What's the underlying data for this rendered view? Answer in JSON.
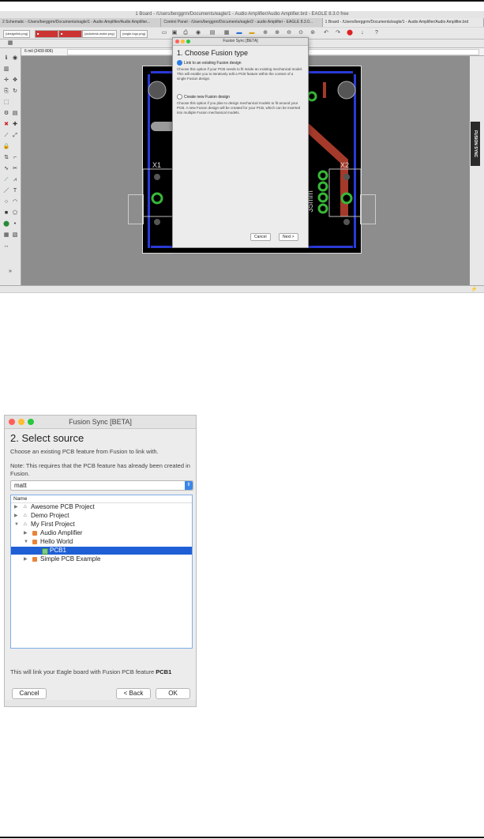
{
  "app": {
    "window_title": "1 Board - /Users/berggrm/Documents/eagle/1 - Audio Amplifier/Audio Amplifier.brd - EAGLE 8.3.0 free",
    "tabs": [
      "2 Schematic - /Users/berggrm/Documents/eagle/1 - Audio Amplifier/Audio Amplifier...",
      "Control Panel - /Users/berggrm/Documents/eagle/2 - audio Amplifier - EAGLE 8.3.0...",
      "1 Board - /Users/berggrm/Documents/eagle/1 - Audio Amplifier/Audio Amplifier.brd"
    ],
    "toolbar_images": [
      "(autodesk-make.png)",
      "(eagle-logo.png)",
      "(designlink.png)"
    ],
    "grid_readout": "6 mil (2439 806)",
    "fusion_sync_tab": "FUSION SYNC",
    "board_labels": {
      "x1": "X1",
      "x2": "X2",
      "dim": "35mm"
    }
  },
  "dialog1": {
    "title": "Fusion Sync [BETA]",
    "heading": "1. Choose Fusion type",
    "option1": "Link to an existing Fusion design",
    "option1_desc": "Choose this option if your PCB needs to fit inside an existing mechanical model. This will enable you to iteratively edit a PCB feature within the context of a single Fusion design.",
    "option2": "Create new Fusion design",
    "option2_desc": "Choose this option if you plan to design mechanical models to fit around your PCB. A new Fusion design will be created for your PCB, which can be inserted into multiple Fusion mechanical models.",
    "cancel": "Cancel",
    "next": "Next >"
  },
  "dialog2": {
    "title": "Fusion Sync [BETA]",
    "heading": "2. Select source",
    "subtitle": "Choose an existing PCB feature from Fusion to link with.",
    "note": "Note: This requires that the PCB feature has already been created in Fusion.",
    "account": "matt",
    "tree_header": "Name",
    "tree": [
      {
        "label": "Awesome PCB Project",
        "level": 0,
        "expanded": false,
        "icon": "project-icon",
        "selected": false
      },
      {
        "label": "Demo Project",
        "level": 0,
        "expanded": false,
        "icon": "project-icon",
        "selected": false
      },
      {
        "label": "My First Project",
        "level": 0,
        "expanded": true,
        "icon": "project-icon",
        "selected": false
      },
      {
        "label": "Audio Amplifier",
        "level": 1,
        "expanded": false,
        "icon": "design-icon",
        "selected": false
      },
      {
        "label": "Hello World",
        "level": 1,
        "expanded": true,
        "icon": "design-icon",
        "selected": false
      },
      {
        "label": "PCB1",
        "level": 2,
        "expanded": null,
        "icon": "pcb-icon",
        "selected": true
      },
      {
        "label": "Simple PCB Example",
        "level": 1,
        "expanded": false,
        "icon": "design-icon",
        "selected": false
      }
    ],
    "link_text": "This will link your Eagle board with Fusion PCB feature ",
    "link_feature": "PCB1",
    "cancel": "Cancel",
    "back": "< Back",
    "ok": "OK"
  }
}
